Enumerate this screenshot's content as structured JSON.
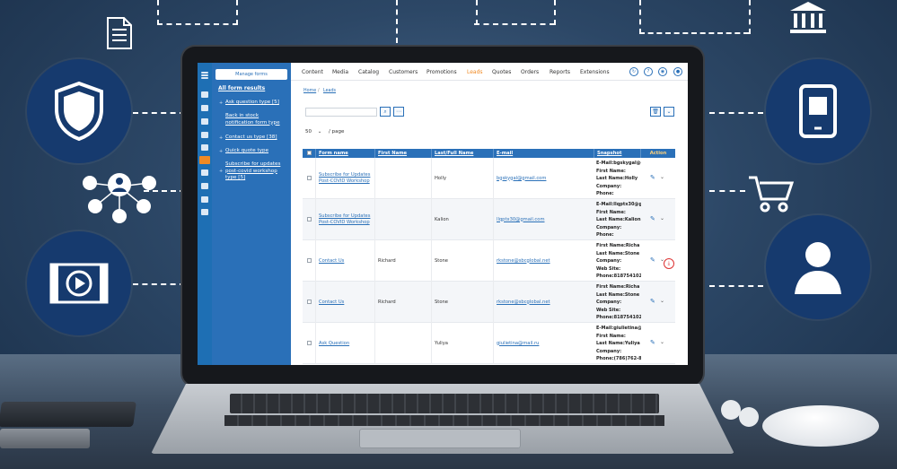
{
  "admin": {
    "manage_forms_label": "Manage forms",
    "sidebar": {
      "all_results": "All form results",
      "items": [
        {
          "label": "Ask question type [5]"
        },
        {
          "label": "Back in stock notification form type"
        },
        {
          "label": "Contact us type [38]"
        },
        {
          "label": "Quick quote type"
        },
        {
          "label": "Subscribe for updates post-covid workshop type [5]"
        }
      ]
    },
    "nav": {
      "items": [
        "Content",
        "Media",
        "Catalog",
        "Customers",
        "Promotions",
        "Leads",
        "Quotes",
        "Orders",
        "Reports",
        "Extensions"
      ],
      "active": "Leads",
      "help_icon_text": "?"
    },
    "breadcrumb": {
      "home": "Home",
      "separator": "/",
      "current": "Leads"
    },
    "per_page": {
      "value": "50",
      "suffix": "/ page"
    },
    "table": {
      "columns": [
        "Form name",
        "First Name",
        "Last/Full Name",
        "E-mail",
        "Snapshot",
        "Action"
      ],
      "rows": [
        {
          "form_name": "Subscribe for Updates Post-COVID Workshop",
          "first_name": "",
          "last_name": "Holly",
          "email": "bgskygal@gmail.com",
          "snapshot": [
            "E-Mail:bgskygal@g",
            "First Name:",
            "Last Name:Holly",
            "Company:",
            "Phone:"
          ]
        },
        {
          "form_name": "Subscribe for Updates Post-COVID Workshop",
          "first_name": "",
          "last_name": "Kalion",
          "email": "llqptx30@gmail.com",
          "snapshot": [
            "E-Mail:llqptx30@g",
            "First Name:",
            "Last Name:Kalion",
            "Company:",
            "Phone:"
          ]
        },
        {
          "form_name": "Contact Us",
          "first_name": "Richard",
          "last_name": "Stone",
          "email": "rkstone@sbcglobal.net",
          "snapshot": [
            "First Name:Richa",
            "Last Name:Stone",
            "Company:",
            "Web Site:",
            "Phone:818754102"
          ]
        },
        {
          "form_name": "Contact Us",
          "first_name": "Richard",
          "last_name": "Stone",
          "email": "rkstone@sbcglobal.net",
          "snapshot": [
            "First Name:Richa",
            "Last Name:Stone",
            "Company:",
            "Web Site:",
            "Phone:818754102"
          ]
        },
        {
          "form_name": "Ask Question",
          "first_name": "",
          "last_name": "Yuliya",
          "email": "giulietina@mail.ru",
          "snapshot": [
            "E-Mail:giulietina@",
            "First Name:",
            "Last Name:Yuliya",
            "Company:",
            "Phone:(786)762-8"
          ]
        }
      ]
    }
  },
  "colors": {
    "accent": "#2a70b8",
    "active_nav": "#f08a24",
    "circle": "#163a6e"
  },
  "icons": [
    "document-icon",
    "bank-icon",
    "shield-icon",
    "network-users-icon",
    "video-icon",
    "smartphone-icon",
    "shopping-cart-icon",
    "user-icon"
  ]
}
